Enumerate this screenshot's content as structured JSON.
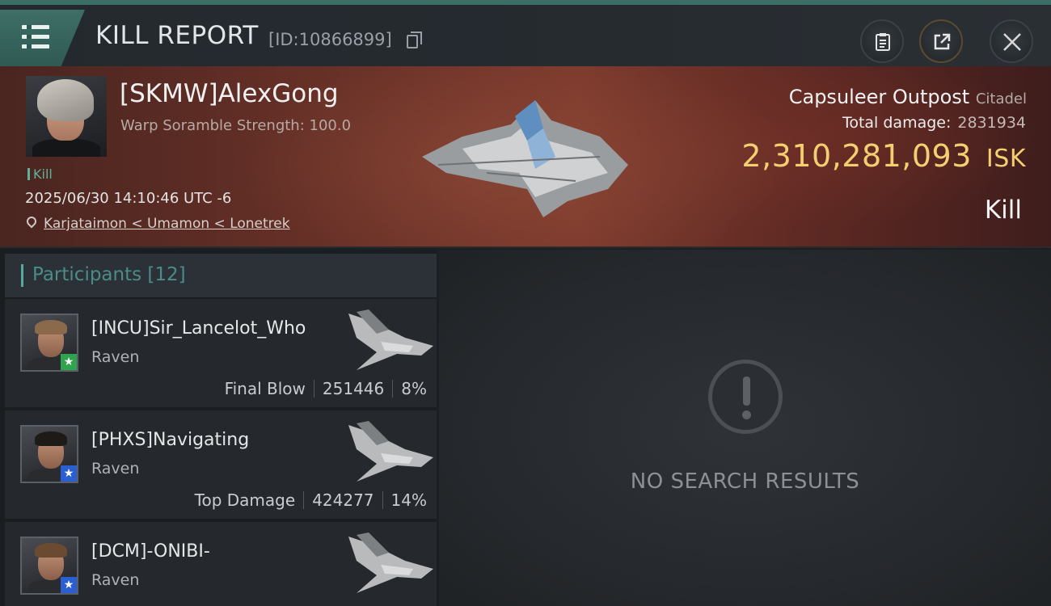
{
  "header": {
    "title": "KILL REPORT",
    "report_id": "[ID:10866899]",
    "icons": [
      "menu-icon",
      "copy-icon",
      "clipboard-icon",
      "share-icon",
      "close-icon"
    ]
  },
  "victim": {
    "name": "[SKMW]AlexGong",
    "subtitle": "Warp Soramble Strength: 100.0",
    "tag": "Kill",
    "time": "2025/06/30 14:10:46 UTC -6",
    "location": "Karjataimon < Umamon < Lonetrek"
  },
  "target": {
    "name": "Capsuleer Outpost",
    "class": "Citadel",
    "total_damage_label": "Total damage:",
    "total_damage": "2831934",
    "isk_value": "2,310,281,093",
    "isk_unit": "ISK",
    "result": "Kill"
  },
  "participants": {
    "label": "Participants",
    "count": "[12]",
    "items": [
      {
        "name": "[INCU]Sir_Lancelot_Who",
        "ship": "Raven",
        "role": "Final Blow",
        "damage": "251446",
        "percent": "8%",
        "badge": "★",
        "badge_color": "#2fa34e"
      },
      {
        "name": "[PHXS]Navigating",
        "ship": "Raven",
        "role": "Top Damage",
        "damage": "424277",
        "percent": "14%",
        "badge": "★",
        "badge_color": "#2b5fd1"
      },
      {
        "name": "[DCM]-ONIBI-",
        "ship": "Raven",
        "badge": "★",
        "badge_color": "#2b5fd1"
      }
    ]
  },
  "results": {
    "empty_text": "NO SEARCH RESULTS"
  },
  "colors": {
    "accent_teal": "#3b6f66",
    "isk_gold": "#f4cf72",
    "kill_green": "#5fb39c"
  }
}
